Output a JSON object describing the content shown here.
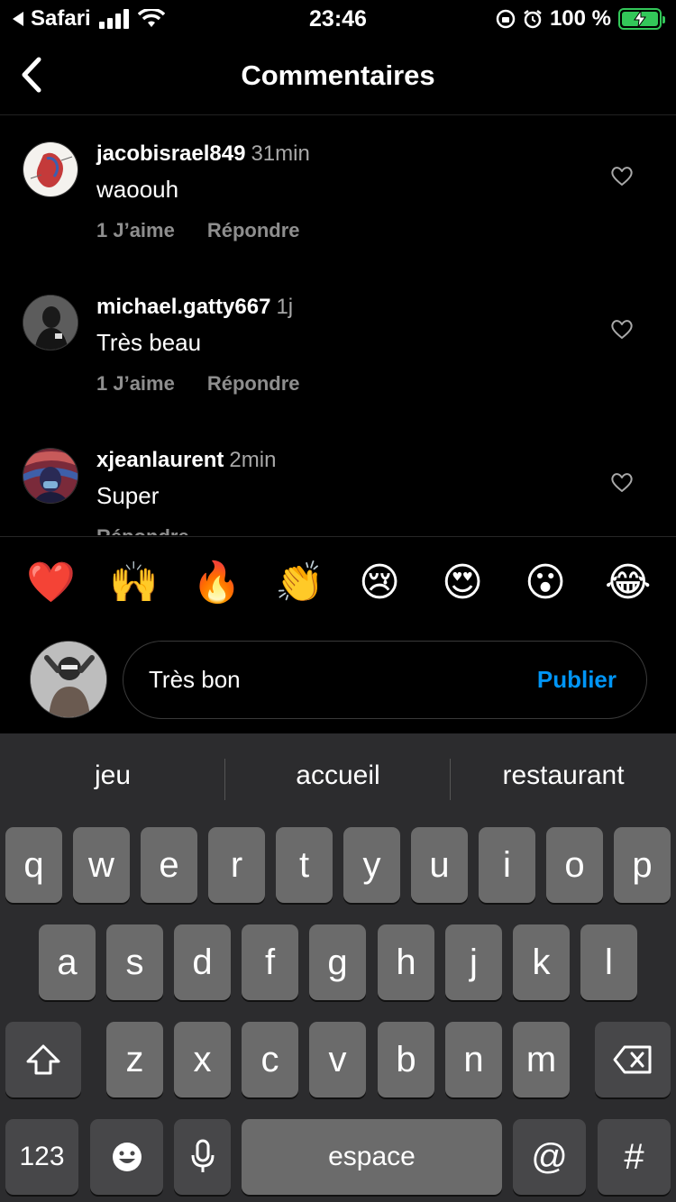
{
  "status_bar": {
    "back_app": "Safari",
    "time": "23:46",
    "battery": "100 %"
  },
  "header": {
    "title": "Commentaires"
  },
  "comments": [
    {
      "username": "jacobisrael849",
      "time": "31min",
      "text": "waoouh",
      "likes": "1 J’aime",
      "reply": "Répondre"
    },
    {
      "username": "michael.gatty667",
      "time": "1j",
      "text": "Très beau",
      "likes": "1 J’aime",
      "reply": "Répondre"
    },
    {
      "username": "xjeanlaurent",
      "time": "2min",
      "text": "Super",
      "likes": "",
      "reply": "Répondre"
    }
  ],
  "emoji_bar": [
    "❤️",
    "🙌",
    "🔥",
    "👏",
    "😢",
    "😍",
    "😮",
    "😂"
  ],
  "composer": {
    "value": "Très bon",
    "publish": "Publier"
  },
  "keyboard": {
    "suggestions": [
      "jeu",
      "accueil",
      "restaurant"
    ],
    "row1": [
      "q",
      "w",
      "e",
      "r",
      "t",
      "y",
      "u",
      "i",
      "o",
      "p"
    ],
    "row2": [
      "a",
      "s",
      "d",
      "f",
      "g",
      "h",
      "j",
      "k",
      "l"
    ],
    "row3": [
      "z",
      "x",
      "c",
      "v",
      "b",
      "n",
      "m"
    ],
    "numbers_key": "123",
    "space_key": "espace",
    "at_key": "@",
    "hash_key": "#"
  }
}
